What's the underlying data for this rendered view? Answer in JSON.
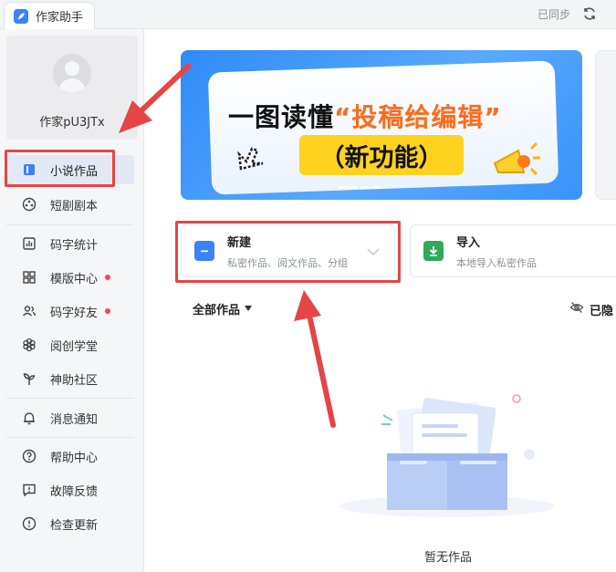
{
  "tab": {
    "title": "作家助手"
  },
  "header": {
    "sync_status": "已同步"
  },
  "profile": {
    "username": "作家pU3JTx"
  },
  "sidebar": {
    "items": [
      {
        "label": "小说作品"
      },
      {
        "label": "短剧剧本"
      },
      {
        "label": "码字统计"
      },
      {
        "label": "模版中心"
      },
      {
        "label": "码字好友"
      },
      {
        "label": "阅创学堂"
      },
      {
        "label": "神助社区"
      },
      {
        "label": "消息通知"
      },
      {
        "label": "帮助中心"
      },
      {
        "label": "故障反馈"
      },
      {
        "label": "检查更新"
      }
    ]
  },
  "banner": {
    "title_prefix": "一图读懂",
    "title_highlight": "“投稿给编辑”",
    "subtitle": "（新功能）"
  },
  "actions": {
    "new": {
      "title": "新建",
      "desc": "私密作品、阅文作品、分组"
    },
    "import": {
      "title": "导入",
      "desc": "本地导入私密作品"
    }
  },
  "works": {
    "filter_label": "全部作品",
    "hidden_label": "已隐",
    "empty_text": "暂无作品"
  },
  "colors": {
    "accent": "#3b82f6",
    "annotation": "#e64545",
    "banner_yellow": "#ffd21f"
  }
}
